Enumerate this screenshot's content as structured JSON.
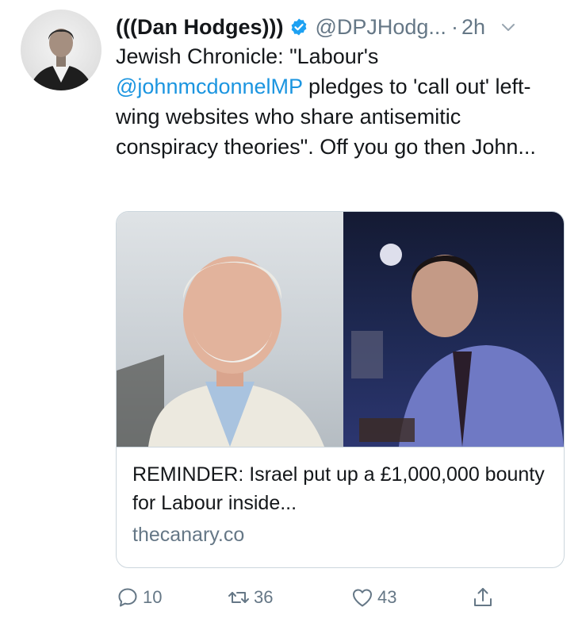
{
  "tweet": {
    "author_name": "(((Dan Hodges)))",
    "handle": "@DPJHodg...",
    "separator": "·",
    "time": "2h",
    "text_before": "Jewish Chronicle: \"Labour's ",
    "mention": "@johnmcdonnelMP",
    "text_after": " pledges to 'call out' left-wing websites who share antisemitic conspiracy theories\". Off you go then John..."
  },
  "card": {
    "title": "REMINDER: Israel put up a £1,000,000 bounty for Labour inside...",
    "domain": "thecanary.co"
  },
  "actions": {
    "replies": "10",
    "retweets": "36",
    "likes": "43"
  },
  "icons": {
    "verified": "verified-badge-icon",
    "more": "chevron-down-icon",
    "reply": "reply-icon",
    "retweet": "retweet-icon",
    "like": "heart-icon",
    "share": "share-icon"
  },
  "colors": {
    "link": "#1b95e0",
    "secondary_text": "#657786",
    "verified": "#1da1f2",
    "border": "#ccd6dd"
  }
}
